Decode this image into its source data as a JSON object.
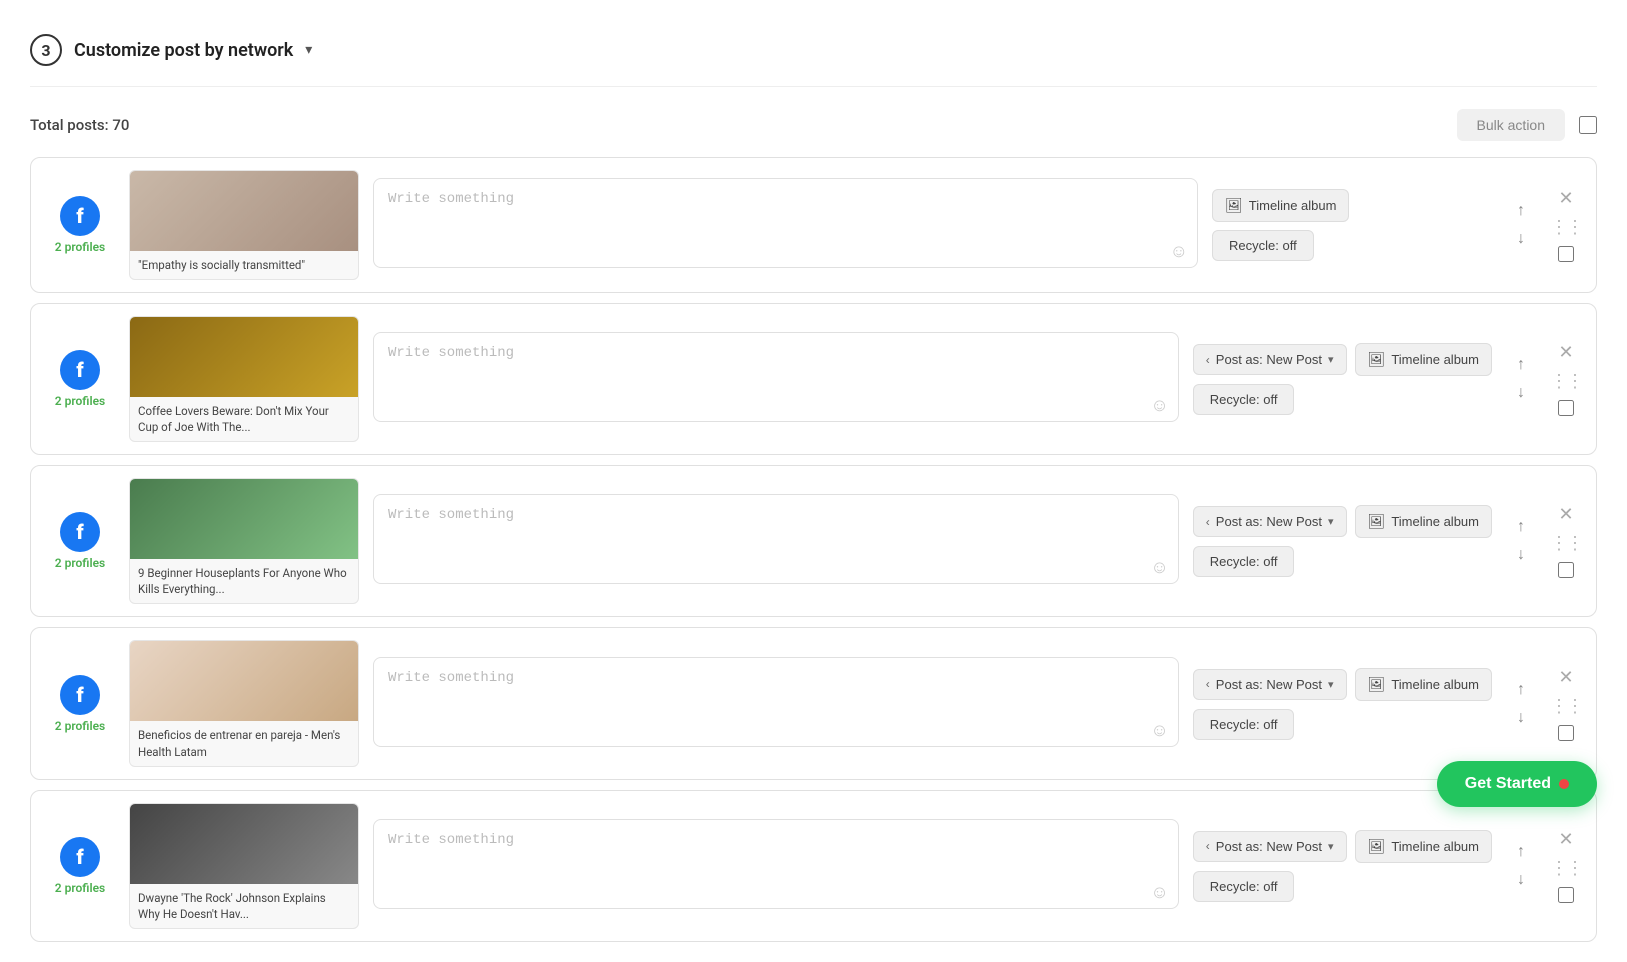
{
  "header": {
    "step": "3",
    "title": "Customize post by network",
    "chevron": "▾"
  },
  "toolbar": {
    "total_posts_label": "Total posts: 70",
    "bulk_action_label": "Bulk action"
  },
  "posts": [
    {
      "id": "post-1",
      "profiles_label": "2 profiles",
      "article_title": "\"Empathy is socially transmitted\"",
      "image_class": "img-empathy",
      "write_placeholder": "Write something",
      "post_as": null,
      "timeline_label": "Timeline album",
      "recycle_label": "Recycle: off"
    },
    {
      "id": "post-2",
      "profiles_label": "2 profiles",
      "article_title": "Coffee Lovers Beware: Don't Mix Your Cup of Joe With The...",
      "image_class": "img-coffee",
      "write_placeholder": "Write something",
      "post_as": "Post as: New Post",
      "timeline_label": "Timeline album",
      "recycle_label": "Recycle: off"
    },
    {
      "id": "post-3",
      "profiles_label": "2 profiles",
      "article_title": "9 Beginner Houseplants For Anyone Who Kills Everything...",
      "image_class": "img-plants",
      "write_placeholder": "Write something",
      "post_as": "Post as: New Post",
      "timeline_label": "Timeline album",
      "recycle_label": "Recycle: off"
    },
    {
      "id": "post-4",
      "profiles_label": "2 profiles",
      "article_title": "Beneficios de entrenar en pareja - Men's Health Latam",
      "image_class": "img-exercise",
      "write_placeholder": "Write something",
      "post_as": "Post as: New Post",
      "timeline_label": "Timeline album",
      "recycle_label": "Recycle: off"
    },
    {
      "id": "post-5",
      "profiles_label": "2 profiles",
      "article_title": "Dwayne 'The Rock' Johnson Explains Why He Doesn't Hav...",
      "image_class": "img-dwayne",
      "write_placeholder": "Write something",
      "post_as": "Post as: New Post",
      "timeline_label": "Timeline album",
      "recycle_label": "Recycle: off"
    }
  ],
  "get_started_label": "Get Started"
}
